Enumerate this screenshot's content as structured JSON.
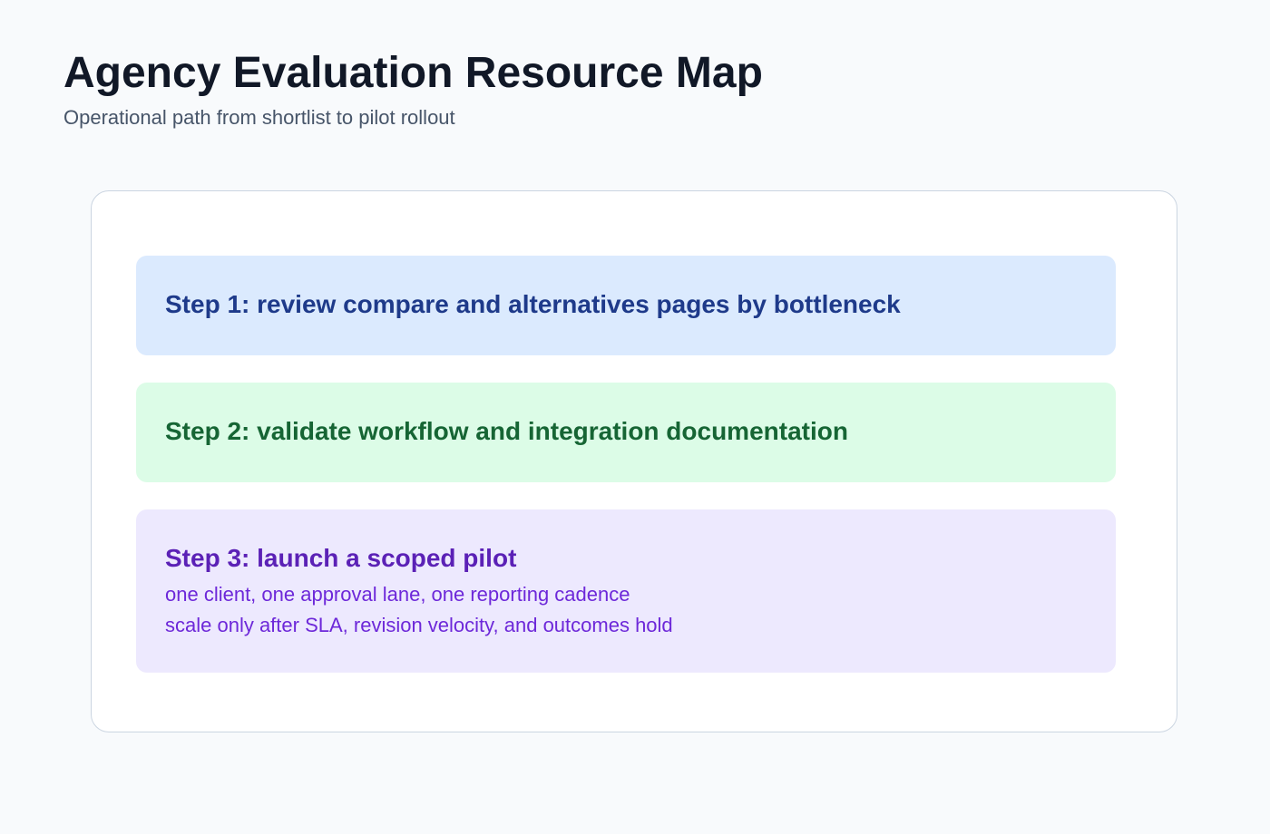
{
  "header": {
    "title": "Agency Evaluation Resource Map",
    "subtitle": "Operational path from shortlist to pilot rollout"
  },
  "steps": [
    {
      "title": "Step 1: review compare and alternatives pages by bottleneck",
      "details": []
    },
    {
      "title": "Step 2: validate workflow and integration documentation",
      "details": []
    },
    {
      "title": "Step 3: launch a scoped pilot",
      "details": [
        "one client, one approval lane, one reporting cadence",
        "scale only after SLA, revision velocity, and outcomes hold"
      ]
    }
  ],
  "colors": {
    "background": "#f8fafc",
    "card_border": "#cbd5e1",
    "step1_fill": "#dbeafe",
    "step1_text": "#1e3a8a",
    "step2_fill": "#dcfce7",
    "step2_text": "#166534",
    "step3_fill": "#ede9fe",
    "step3_text": "#5b21b6"
  }
}
